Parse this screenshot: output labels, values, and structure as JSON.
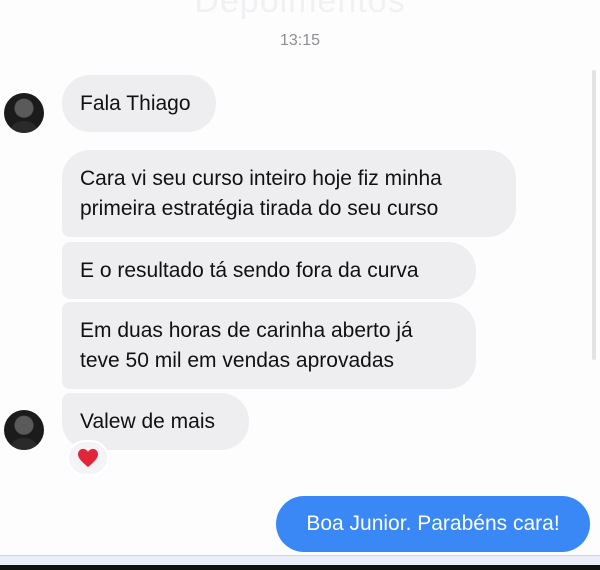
{
  "header": {
    "title": "Depoimentos"
  },
  "conversation": {
    "timestamp": "13:15",
    "incoming": [
      {
        "text": "Fala Thiago"
      },
      {
        "line1": "Cara vi seu curso inteiro hoje fiz  minha",
        "line2": "primeira estratégia tirada do seu curso"
      },
      {
        "text": "E o resultado tá sendo fora da curva"
      },
      {
        "line1": "Em duas horas de carinha aberto já",
        "line2": "teve 50 mil em vendas aprovadas"
      },
      {
        "text": "Valew de mais"
      }
    ],
    "reaction": {
      "icon": "heart-icon",
      "color": "#e0273a"
    },
    "outgoing": [
      {
        "text": "Boa Junior. Parabéns cara!"
      }
    ]
  },
  "colors": {
    "incoming_bubble": "#eeeef0",
    "outgoing_bubble": "#3a87f6"
  }
}
